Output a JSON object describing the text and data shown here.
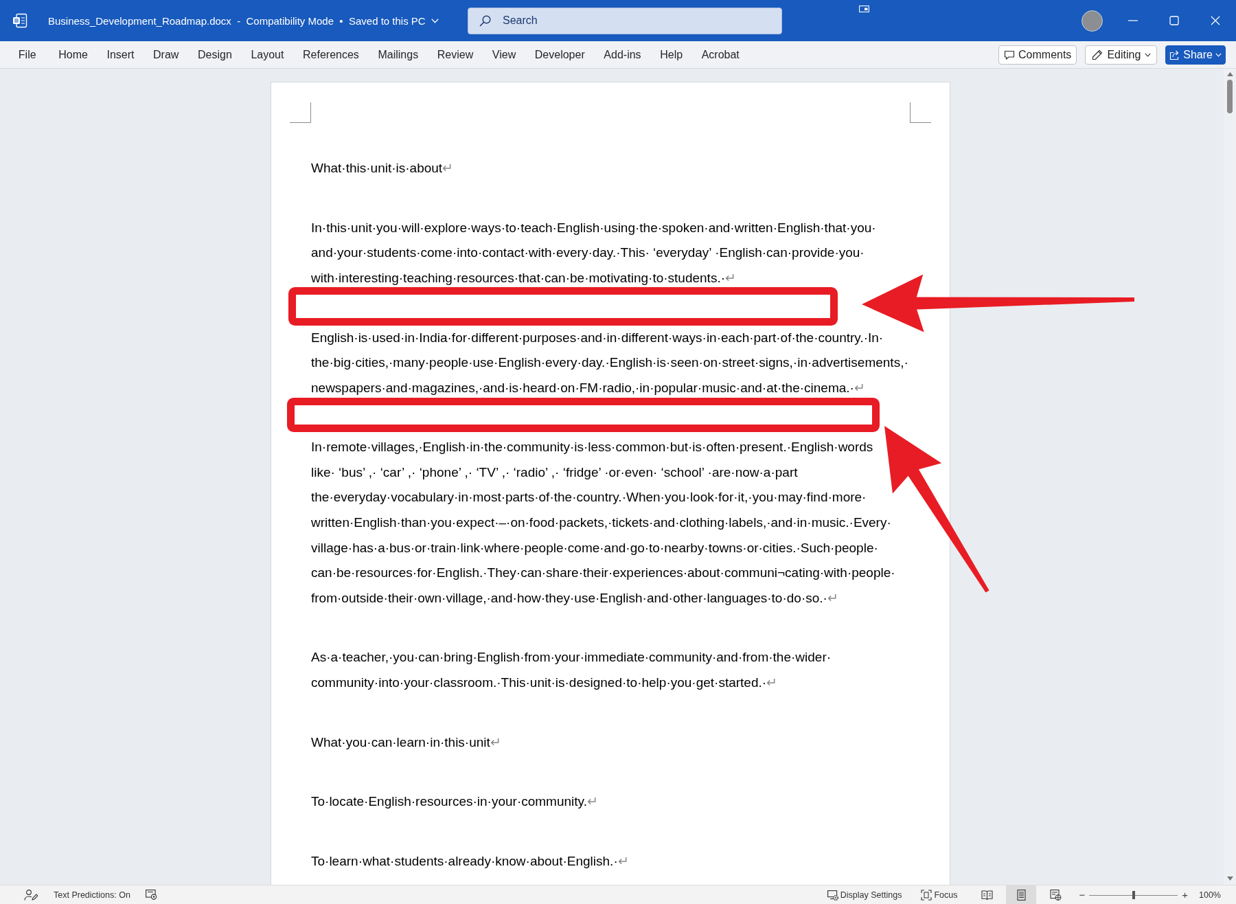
{
  "title_bar": {
    "document_title": "Business_Development_Roadmap.docx  -  Compatibility Mode  •  Saved to this PC",
    "search": {
      "placeholder": "Search"
    }
  },
  "ribbon": {
    "tabs": [
      {
        "label": "File",
        "selected": false
      },
      {
        "label": "Home",
        "selected": false
      },
      {
        "label": "Insert",
        "selected": false
      },
      {
        "label": "Draw",
        "selected": false
      },
      {
        "label": "Design",
        "selected": false
      },
      {
        "label": "Layout",
        "selected": false
      },
      {
        "label": "References",
        "selected": false
      },
      {
        "label": "Mailings",
        "selected": false
      },
      {
        "label": "Review",
        "selected": false
      },
      {
        "label": "View",
        "selected": false
      },
      {
        "label": "Developer",
        "selected": false
      },
      {
        "label": "Add-ins",
        "selected": false
      },
      {
        "label": "Help",
        "selected": false
      },
      {
        "label": "Acrobat",
        "selected": false
      }
    ],
    "comments_button": "Comments",
    "editing_button": "Editing",
    "share_button": "Share"
  },
  "document": {
    "paragraphs": [
      {
        "lines": [
          "What·this·unit·is·about"
        ],
        "mark": "↵"
      },
      {
        "lines": [
          "In·this·unit·you·will·explore·ways·to·teach·English·using·the·spoken·and·written·English·that·you·",
          "and·your·students·come·into·contact·with·every·day.·This· ‘everyday’ ·English·can·provide·you·",
          "with·interesting·teaching·resources·that·can·be·motivating·to·students.·"
        ],
        "mark": "↵"
      },
      {
        "lines": [
          "English·is·used·in·India·for·different·purposes·and·in·different·ways·in·each·part·of·the·country.·In·",
          "the·big·cities,·many·people·use·English·every·day.·English·is·seen·on·street·signs,·in·advertisements,·",
          "newspapers·and·magazines,·and·is·heard·on·FM·radio,·in·popular·music·and·at·the·cinema.·"
        ],
        "mark": "↵"
      },
      {
        "lines": [
          "In·remote·villages,·English·in·the·community·is·less·common·but·is·often·present.·English·words",
          "like· ‘bus’ ,· ‘car’ ,· ‘phone’ ,· ‘TV’ ,· ‘radio’ ,· ‘fridge’ ·or·even· ‘school’ ·are·now·a·part",
          "the·everyday·vocabulary·in·most·parts·of·the·country.·When·you·look·for·it,·you·may·find·more·",
          "written·English·than·you·expect·–·on·food·packets,·tickets·and·clothing·labels,·and·in·music.·Every·",
          "village·has·a·bus·or·train·link·where·people·come·and·go·to·nearby·towns·or·cities.·Such·people·",
          "can·be·resources·for·English.·They·can·share·their·experiences·about·communi¬cating·with·people·",
          "from·outside·their·own·village,·and·how·they·use·English·and·other·languages·to·do·so.·"
        ],
        "mark": "↵"
      },
      {
        "lines": [
          "As·a·teacher,·you·can·bring·English·from·your·immediate·community·and·from·the·wider·",
          "community·into·your·classroom.·This·unit·is·designed·to·help·you·get·started.·"
        ],
        "mark": "↵"
      },
      {
        "lines": [
          "What·you·can·learn·in·this·unit"
        ],
        "mark": "↵"
      },
      {
        "lines": [
          "To·locate·English·resources·in·your·community."
        ],
        "mark": "↵"
      },
      {
        "lines": [
          "To·learn·what·students·already·know·about·English.·"
        ],
        "mark": "↵"
      }
    ]
  },
  "annotations": [
    {
      "kind": "box"
    },
    {
      "kind": "box"
    },
    {
      "kind": "arrow"
    },
    {
      "kind": "arrow"
    }
  ],
  "status_bar": {
    "text_predictions": "Text Predictions: On",
    "display_settings": "Display Settings",
    "focus": "Focus",
    "views": [
      {
        "kind": "read",
        "selected": false
      },
      {
        "kind": "print",
        "selected": true
      },
      {
        "kind": "web",
        "selected": false
      }
    ],
    "zoom": {
      "out": "−",
      "in": "+",
      "level": 0.5,
      "reading": "100%"
    }
  }
}
